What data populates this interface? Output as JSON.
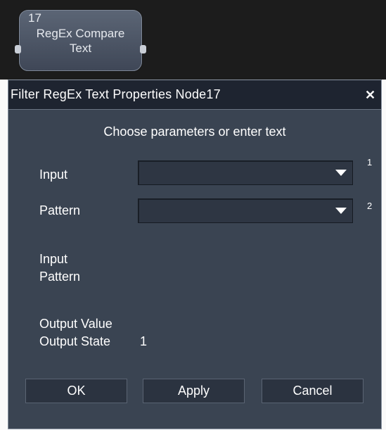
{
  "node": {
    "number": "17",
    "title_line1": "RegEx Compare",
    "title_line2": "Text"
  },
  "dialog": {
    "title": "Filter RegEx Text Properties Node17",
    "close_icon": "close-icon",
    "subtitle": "Choose parameters or enter text",
    "fields": [
      {
        "label": "Input",
        "value": "",
        "index": "1"
      },
      {
        "label": "Pattern",
        "value": "",
        "index": "2"
      }
    ],
    "info": {
      "input_label": "Input",
      "pattern_label": "Pattern",
      "output_value_label": "Output Value",
      "output_state_label": "Output State",
      "output_state_value": "1"
    },
    "buttons": {
      "ok": "OK",
      "apply": "Apply",
      "cancel": "Cancel"
    }
  }
}
